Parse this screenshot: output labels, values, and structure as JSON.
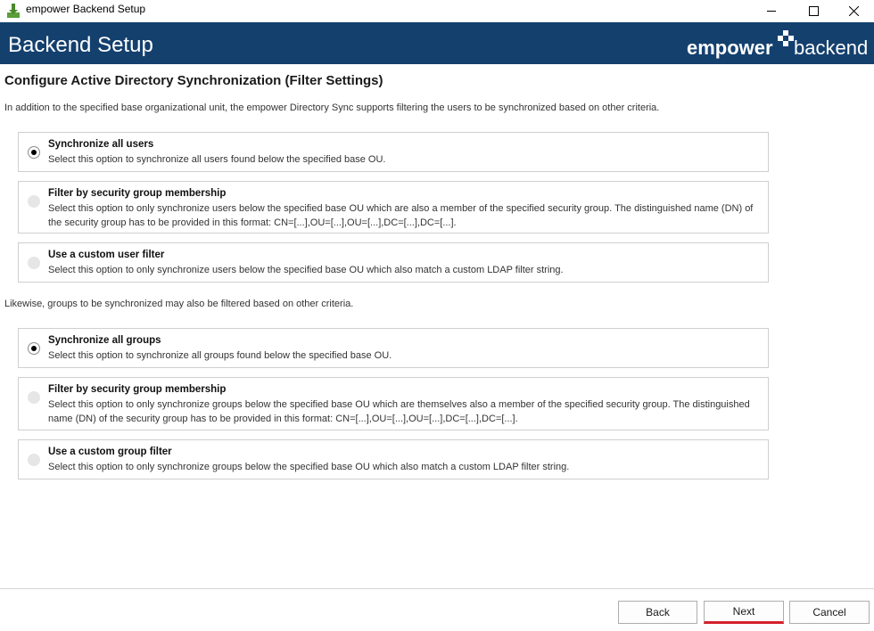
{
  "window": {
    "title": "empower Backend Setup",
    "controls": [
      "minimize",
      "maximize",
      "close"
    ]
  },
  "banner": {
    "title": "Backend Setup",
    "brand_bold": "empower",
    "brand_light": "backend",
    "background_color": "#14406e"
  },
  "page": {
    "heading": "Configure Active Directory Synchronization (Filter Settings)",
    "intro": "In addition to the specified base organizational unit, the empower Directory Sync supports filtering the users to be synchronized based on other criteria.",
    "groups_intro": "Likewise, groups to be synchronized may also be filtered based on other criteria."
  },
  "user_options": [
    {
      "title": "Synchronize all users",
      "description": "Select this option to synchronize all users found below the specified base OU.",
      "selected": true
    },
    {
      "title": "Filter by security group membership",
      "description": "Select this option to only synchronize users below the specified base OU which are also a member of the specified security group. The distinguished name (DN) of the security group has to be provided in this format: CN=[...],OU=[...],OU=[...],DC=[...],DC=[...].",
      "selected": false
    },
    {
      "title": "Use a custom user filter",
      "description": "Select this option to only synchronize users below the specified base OU which also match a custom LDAP filter string.",
      "selected": false
    }
  ],
  "group_options": [
    {
      "title": "Synchronize all groups",
      "description": "Select this option to synchronize all groups found below the specified base OU.",
      "selected": true
    },
    {
      "title": "Filter by security group membership",
      "description": "Select this option to only synchronize groups below the specified base OU which are themselves also a member of the specified security group. The distinguished name (DN) of the security group has to be provided in this format: CN=[...],OU=[...],OU=[...],DC=[...],DC=[...].",
      "selected": false
    },
    {
      "title": "Use a custom group filter",
      "description": "Select this option to only synchronize groups below the specified base OU which also match a custom LDAP filter string.",
      "selected": false
    }
  ],
  "footer": {
    "back_label": "Back",
    "next_label": "Next",
    "cancel_label": "Cancel",
    "next_accent_color": "#d3212c"
  }
}
